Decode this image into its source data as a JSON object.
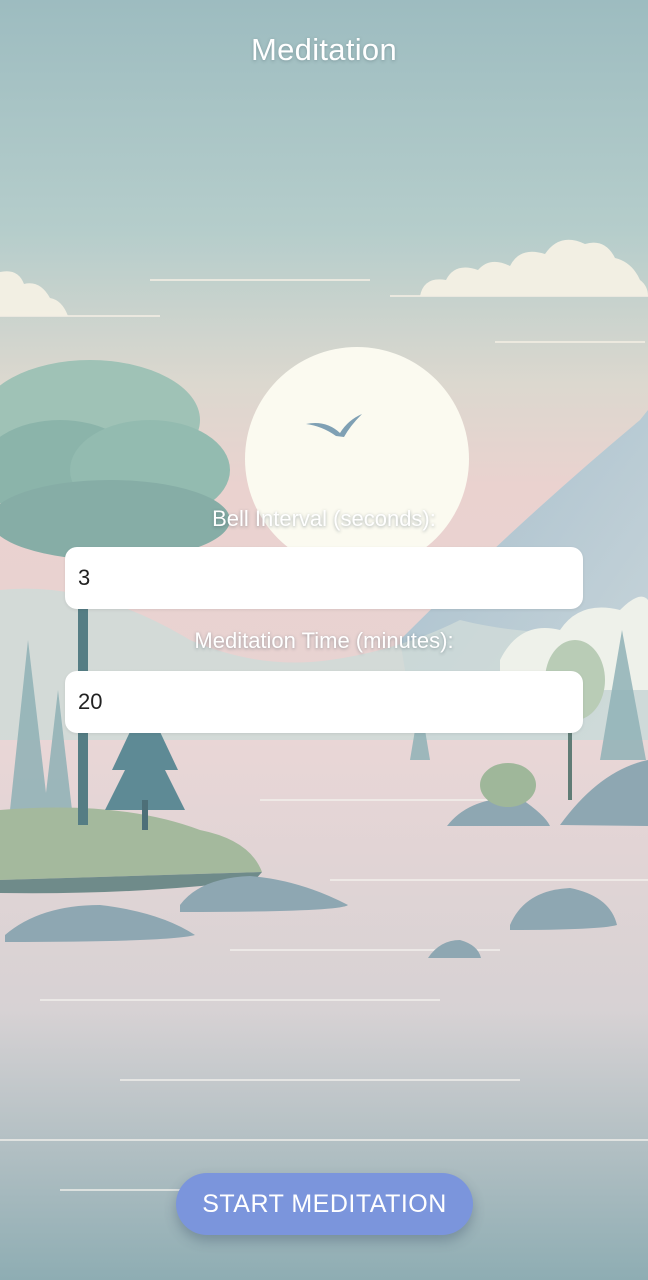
{
  "app": {
    "title": "Meditation"
  },
  "form": {
    "bell_interval": {
      "label": "Bell Interval (seconds):",
      "value": "3"
    },
    "meditation_time": {
      "label": "Meditation Time (minutes):",
      "value": "20"
    }
  },
  "actions": {
    "start_label": "START MEDITATION"
  },
  "background": {
    "scene": "lake-landscape-illustration"
  },
  "colors": {
    "sky_top": "#9dbcc0",
    "sky_pink": "#e8cfcf",
    "water": "#8aaab0",
    "button": "#7b95dc",
    "sun": "#fbfaf0"
  }
}
